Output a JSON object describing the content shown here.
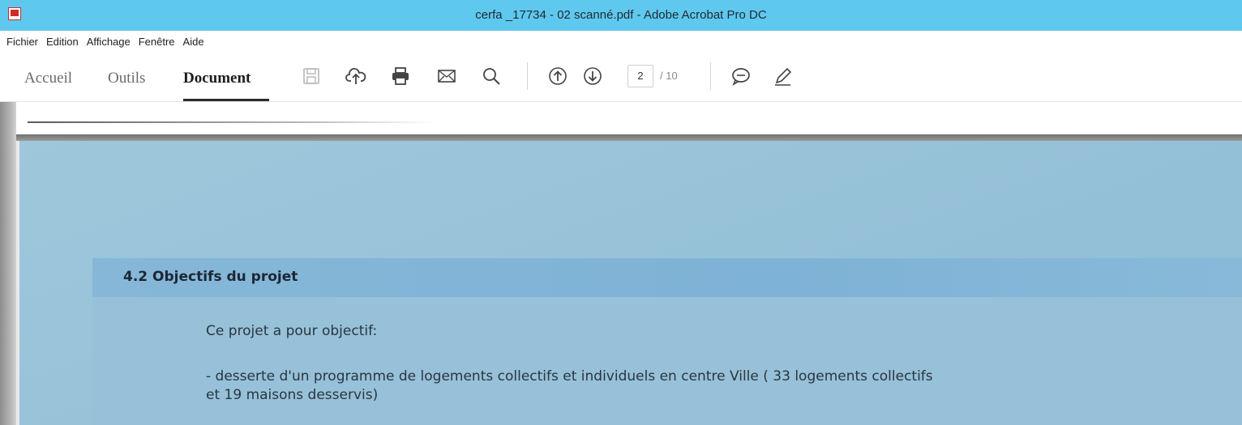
{
  "window": {
    "title": "cerfa _17734 - 02 scanné.pdf - Adobe Acrobat Pro DC"
  },
  "menu": [
    "Fichier",
    "Edition",
    "Affichage",
    "Fenêtre",
    "Aide"
  ],
  "tabs": {
    "home": "Accueil",
    "tools": "Outils",
    "document": "Document"
  },
  "toolbar": {
    "icons": [
      "save-icon",
      "upload-cloud-icon",
      "print-icon",
      "email-icon",
      "search-icon",
      "page-up-icon",
      "page-down-icon",
      "comment-icon",
      "pen-icon"
    ],
    "current_page": "2",
    "total_pages": "/ 10"
  },
  "document": {
    "section_title": "4.2 Objectifs du projet",
    "paragraph_1": "Ce projet  a pour objectif:",
    "paragraph_2_line_1": "- desserte d'un programme de logements collectifs et individuels en centre Ville ( 33 logements collectifs",
    "paragraph_2_line_2": "et 19 maisons desservis)"
  },
  "colors": {
    "titlebar": "#5fc8ee",
    "scan_background": "#97c2d8",
    "section_header": "#7eb2d6"
  }
}
